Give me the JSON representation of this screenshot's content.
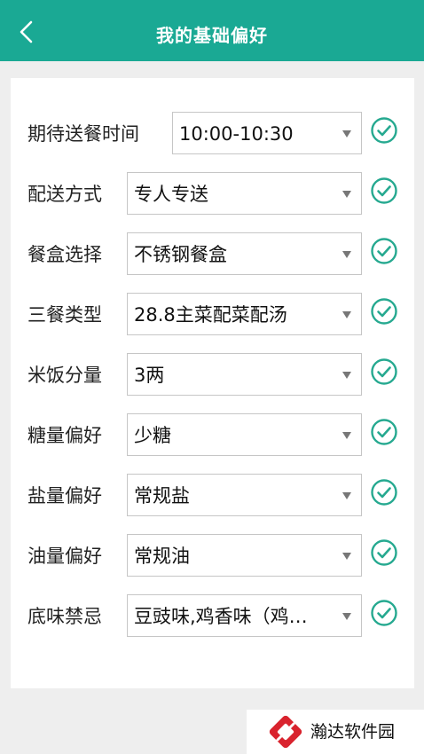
{
  "header": {
    "title": "我的基础偏好"
  },
  "preferences": [
    {
      "label": "期待送餐时间",
      "value": "10:00-10:30"
    },
    {
      "label": "配送方式",
      "value": "专人专送"
    },
    {
      "label": "餐盒选择",
      "value": "不锈钢餐盒"
    },
    {
      "label": "三餐类型",
      "value": "28.8主菜配菜配汤"
    },
    {
      "label": "米饭分量",
      "value": "3两"
    },
    {
      "label": "糖量偏好",
      "value": "少糖"
    },
    {
      "label": "盐量偏好",
      "value": "常规盐"
    },
    {
      "label": "油量偏好",
      "value": "常规油"
    },
    {
      "label": "底味禁忌",
      "value": "豆豉味,鸡香味（鸡…"
    }
  ],
  "watermark": {
    "text": "瀚达软件园"
  },
  "colors": {
    "accent": "#1aa994",
    "check": "#26a990",
    "logo": "#d9232e"
  }
}
